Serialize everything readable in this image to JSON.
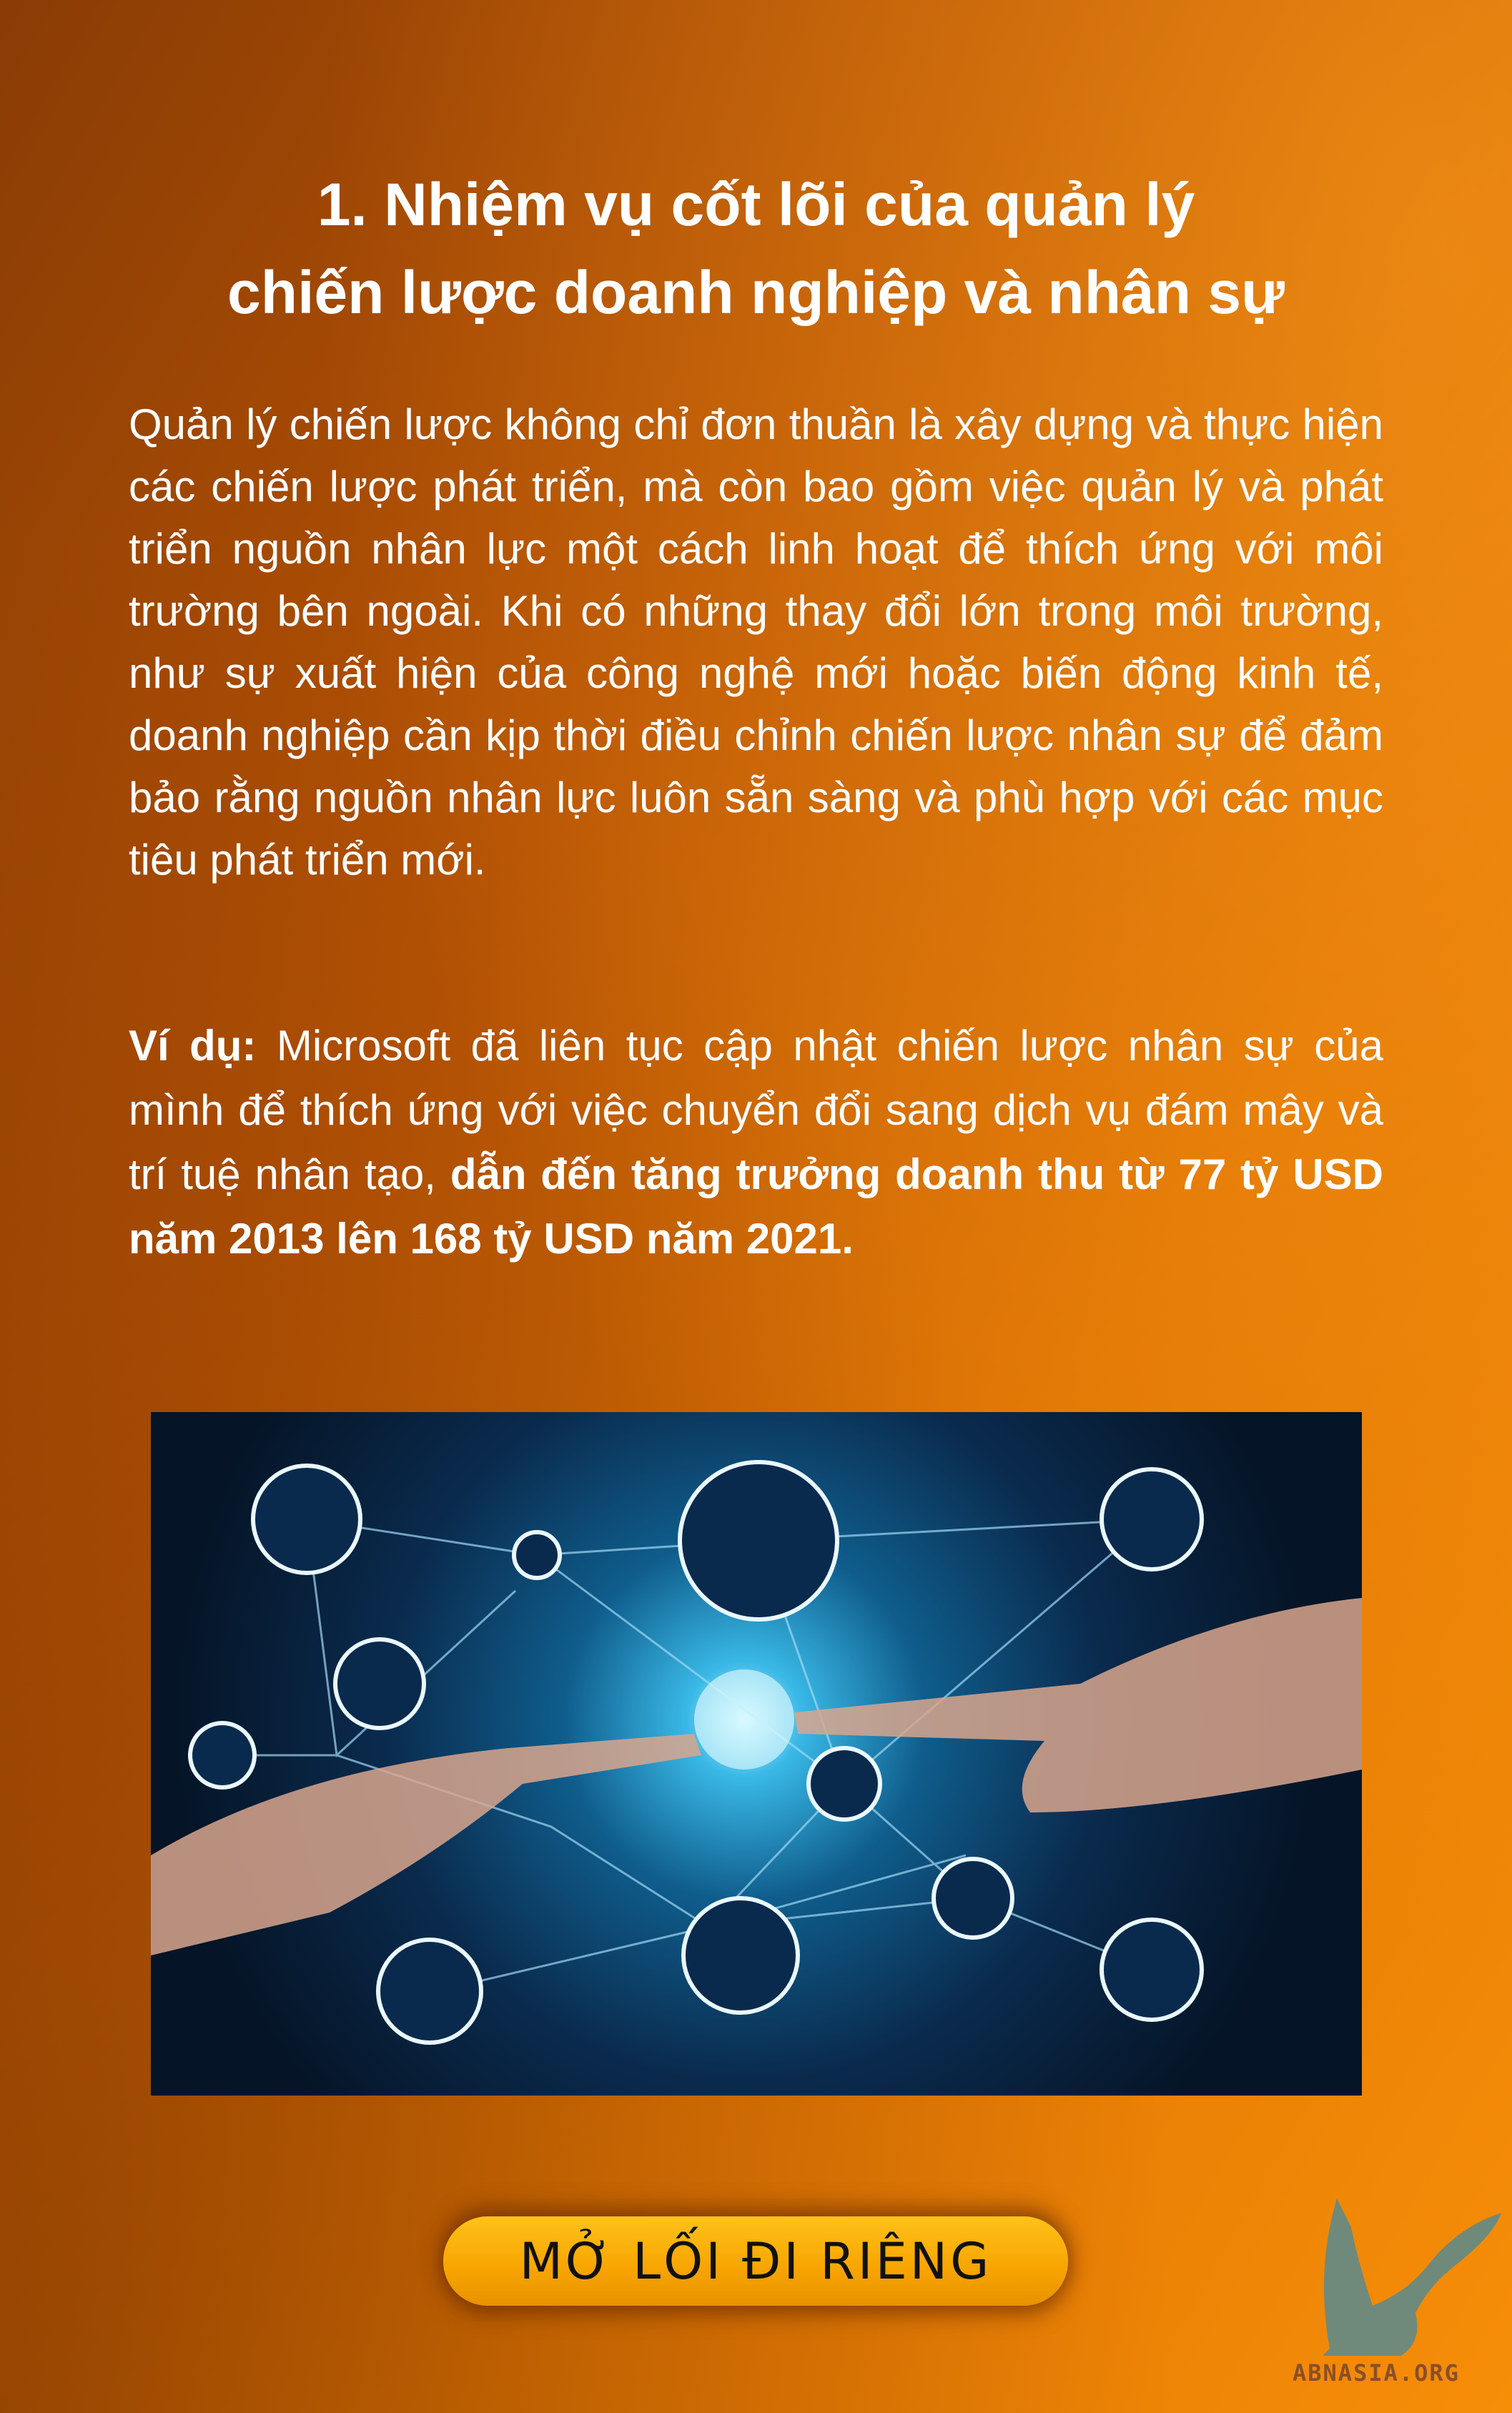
{
  "title": {
    "line1": "1. Nhiệm vụ cốt lõi của quản lý",
    "line2": "chiến lược doanh nghiệp và nhân sự"
  },
  "paragraph1": "Quản lý chiến lược không chỉ đơn thuần là xây dựng và thực hiện các chiến lược phát triển, mà còn bao gồm việc quản lý và phát triển nguồn nhân lực một cách linh hoạt để thích ứng với môi trường bên ngoài. Khi có những thay đổi lớn trong môi trường, như sự xuất hiện của công nghệ mới hoặc biến động kinh tế, doanh nghiệp cần kịp thời điều chỉnh chiến lược nhân sự để đảm bảo rằng nguồn nhân lực luôn sẵn sàng và phù hợp với các mục tiêu phát triển mới.",
  "paragraph2": {
    "label": "Ví dụ:",
    "text": " Microsoft đã liên tục cập nhật chiến lược nhân sự của mình để thích ứng với việc chuyển đổi sang dịch vụ đám mây và trí tuệ nhân tạo, ",
    "highlight": "dẫn đến tăng trưởng doanh thu từ 77 tỷ USD năm 2013 lên 168 tỷ USD năm 2021."
  },
  "button": {
    "label": "MỞ LỐI ĐI RIÊNG"
  },
  "logo": {
    "text": "ABNASIA.ORG"
  }
}
